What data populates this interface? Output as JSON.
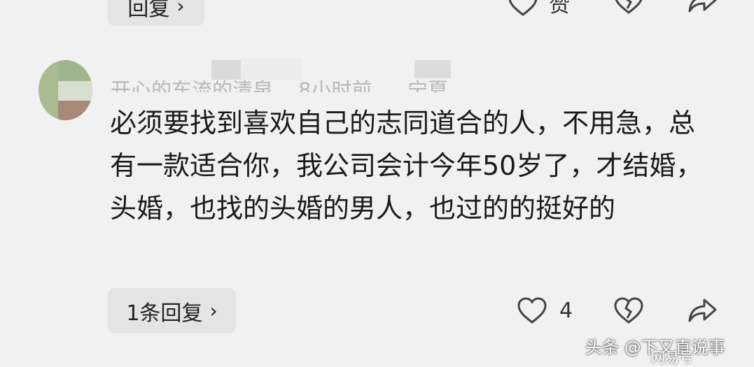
{
  "top_bar": {
    "reply_label": "回复",
    "like_label": "赞"
  },
  "comment": {
    "username": "开心的东流的清泉",
    "time": "8小时前",
    "location": "宁夏",
    "text": "必须要找到喜欢自己的志同道合的人，不用急，总有一款适合你，我公司会计今年50岁了，才结婚，头婚，也找的头婚的男人，也过的的挺好的",
    "replies_label": "1条回复",
    "like_count": "4"
  },
  "icons": {
    "like": "heart-outline-icon",
    "dislike": "broken-heart-icon",
    "share": "share-arrow-icon",
    "chevron": "chevron-right-icon"
  },
  "watermark": {
    "text": "头条 @下又直说事",
    "overlay": "网易号"
  }
}
